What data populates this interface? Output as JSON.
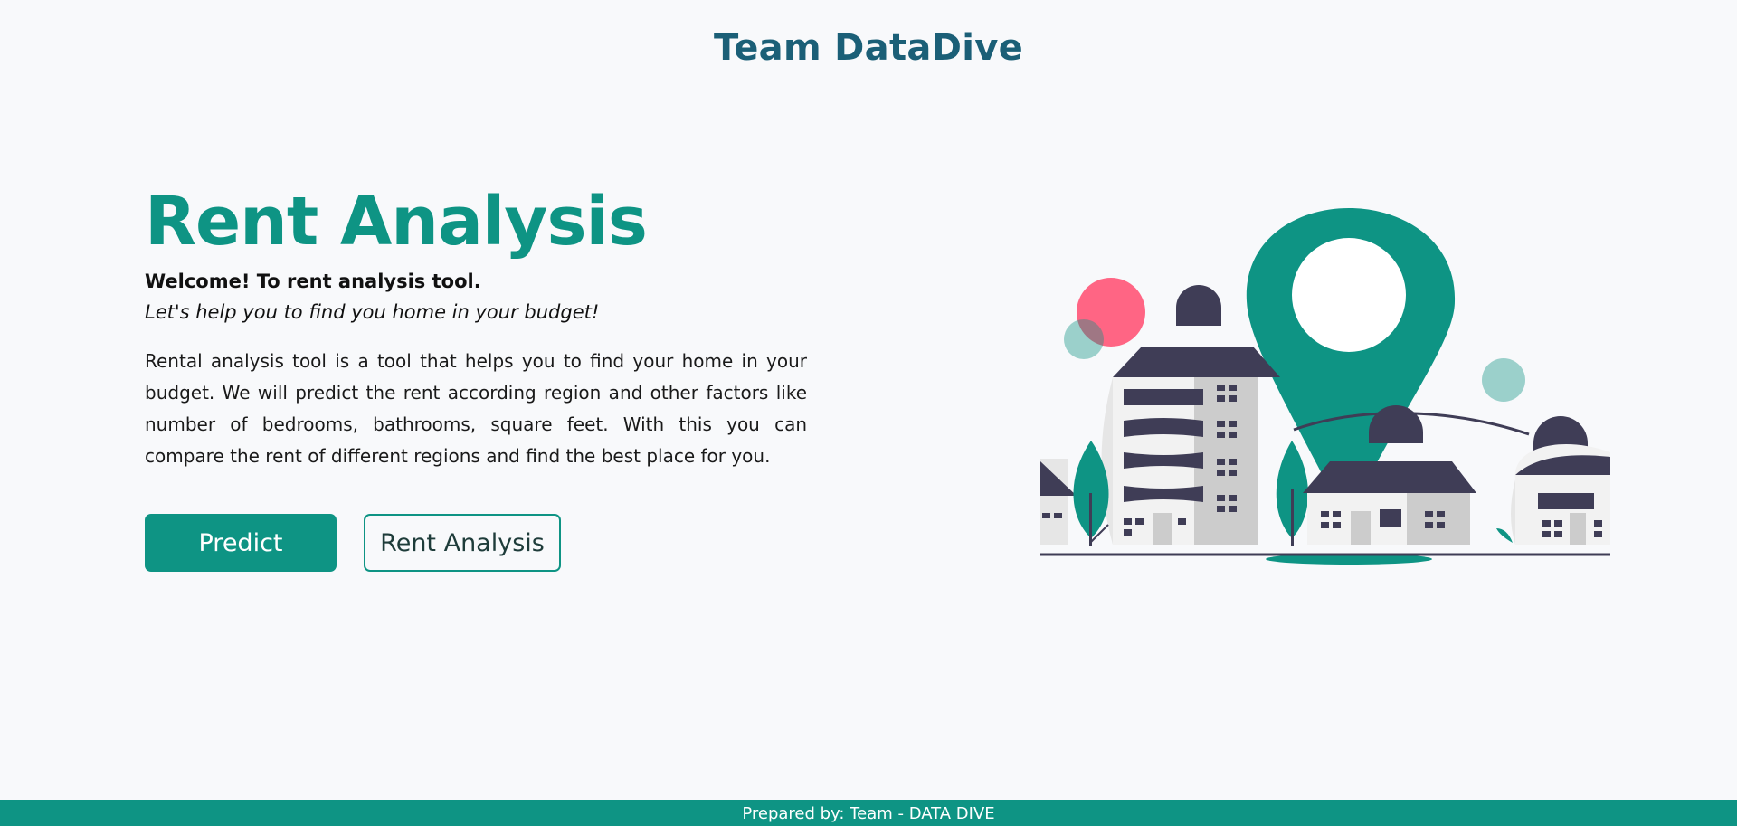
{
  "header": {
    "brand": "Team DataDive"
  },
  "hero": {
    "title": "Rent Analysis",
    "welcome": "Welcome! To rent analysis tool.",
    "tagline": "Let's help you to find you home in your budget!",
    "description": "Rental analysis tool is a tool that helps you to find your home in your budget. We will predict the rent according region and other factors like number of bedrooms, bathrooms, square feet. With this you can compare the rent of different regions and find the best place for you.",
    "buttons": {
      "predict": "Predict",
      "rent_analysis": "Rent Analysis"
    }
  },
  "footer": {
    "text": "Prepared by: Team - DATA DIVE"
  },
  "colors": {
    "accent": "#0e9484",
    "brand": "#1b5f77",
    "pink": "#ff6584",
    "dark": "#3f3d56"
  }
}
